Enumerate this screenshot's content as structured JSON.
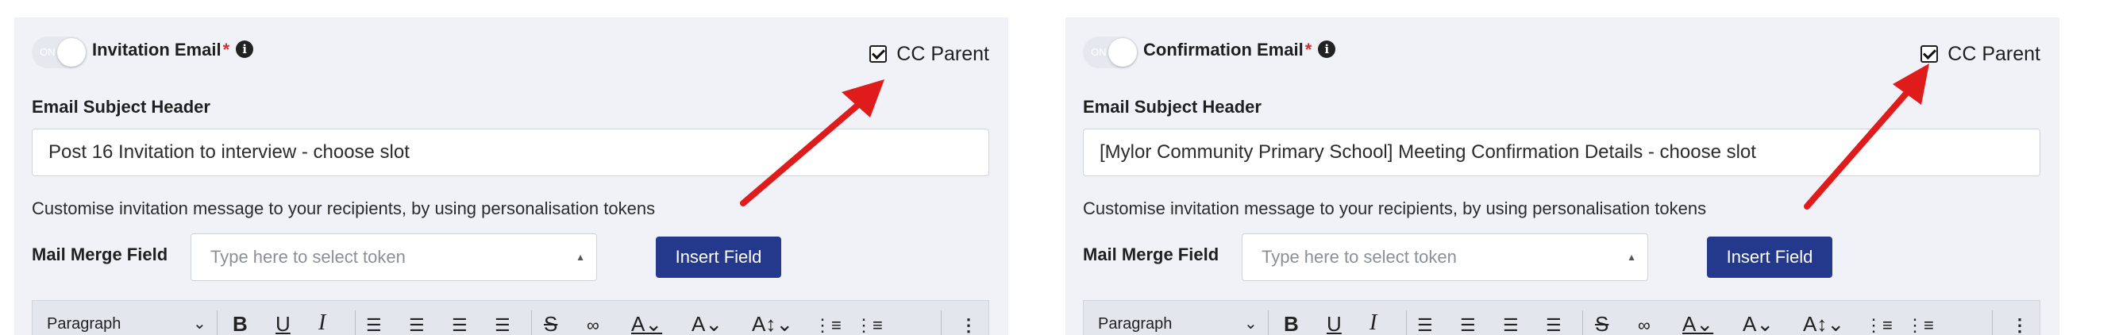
{
  "panels": [
    {
      "toggle_label": "ON",
      "title": "Invitation Email",
      "required_mark": "*",
      "info_icon": "i",
      "cc_label": "CC Parent",
      "subject_label": "Email Subject Header",
      "subject_value": "Post 16 Invitation to interview - choose slot",
      "hint": "Customise invitation message to your recipients, by using personalisation tokens",
      "merge_label": "Mail Merge Field",
      "token_placeholder": "Type here to select token",
      "insert_label": "Insert Field",
      "toolbar": {
        "paragraph": "Paragraph"
      }
    },
    {
      "toggle_label": "ON",
      "title": "Confirmation Email",
      "required_mark": "*",
      "info_icon": "i",
      "cc_label": "CC Parent",
      "subject_label": "Email Subject Header",
      "subject_value": "[Mylor Community Primary School] Meeting Confirmation Details - choose slot",
      "hint": "Customise invitation message to your recipients, by using personalisation tokens",
      "merge_label": "Mail Merge Field",
      "token_placeholder": "Type here to select token",
      "insert_label": "Insert Field",
      "toolbar": {
        "paragraph": "Paragraph"
      }
    }
  ],
  "colors": {
    "arrow": "#e01b1b",
    "accent": "#24398c",
    "required": "#d32f2f"
  },
  "toolbar_icons": [
    "bold-icon",
    "underline-icon",
    "italic-icon",
    "align-left-icon",
    "align-center-icon",
    "align-right-icon",
    "align-justify-icon",
    "strikethrough-icon",
    "link-icon",
    "font-color-icon",
    "font-size-icon",
    "line-height-icon",
    "bulleted-list-icon",
    "numbered-list-icon",
    "more-options-icon"
  ]
}
